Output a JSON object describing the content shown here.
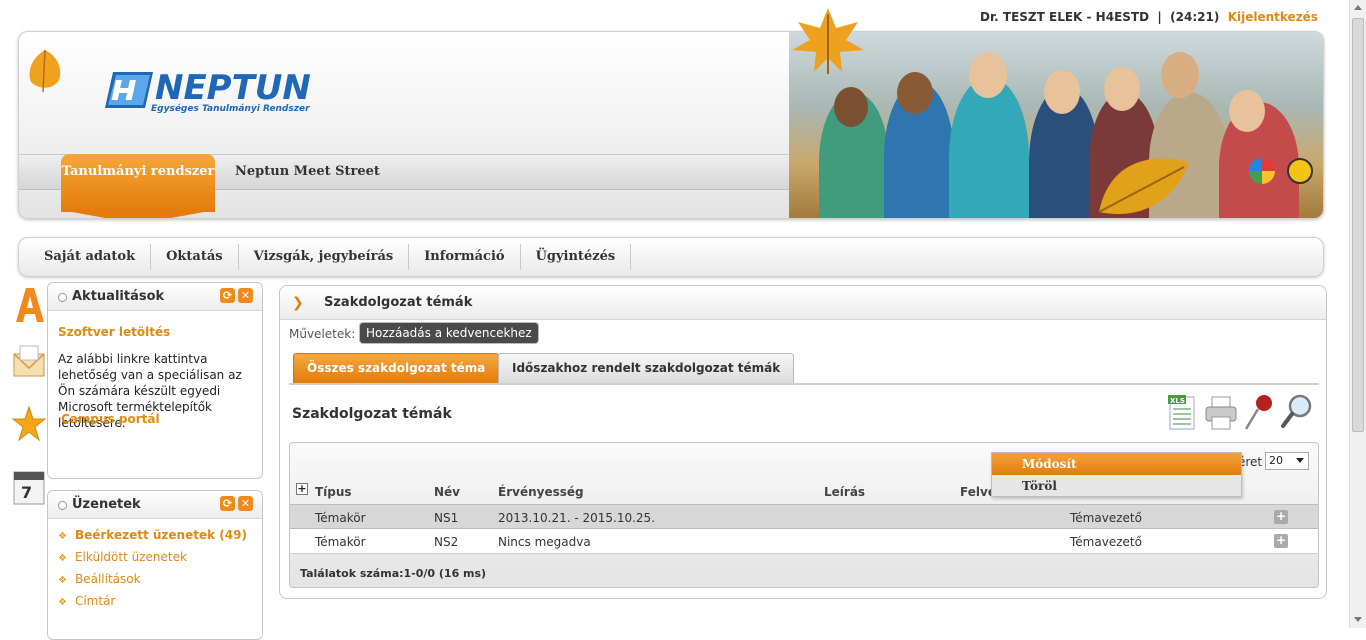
{
  "user": {
    "name": "Dr. TESZT ELEK - H4ESTD",
    "separator": "|",
    "session_timer": "(24:21)",
    "logout": "Kijelentkezés"
  },
  "brand": {
    "logo_text": "NEPTUN",
    "logo_subtitle": "Egységes Tanulmányi Rendszer"
  },
  "header_tabs": [
    {
      "label": "Tanulmányi rendszer",
      "active": true
    },
    {
      "label": "Neptun Meet Street",
      "active": false
    }
  ],
  "main_nav": [
    {
      "label": "Saját adatok"
    },
    {
      "label": "Oktatás"
    },
    {
      "label": "Vizsgák, jegybeírás"
    },
    {
      "label": "Információ"
    },
    {
      "label": "Ügyintézés"
    }
  ],
  "side_icons": [
    "font-size-icon",
    "envelope-icon",
    "favorites-star-icon",
    "calendar-icon"
  ],
  "news_box": {
    "title": "Aktualitások",
    "link_title": "Szoftver letöltés",
    "body": "Az alábbi linkre kattintva lehetőség van a speciálisan az Ön számára készült egyedi Microsoft terméktelepítők letöltésére.",
    "link2": "Campus portál"
  },
  "messages_box": {
    "title": "Üzenetek",
    "items": [
      {
        "label": "Beérkezett üzenetek (49)",
        "bold": true
      },
      {
        "label": "Elküldött üzenetek",
        "bold": false
      },
      {
        "label": "Beállítások",
        "bold": false
      },
      {
        "label": "Címtár",
        "bold": false
      }
    ]
  },
  "content": {
    "title": "Szakdolgozat témák",
    "operations_label": "Műveletek:",
    "add_favorite": "Hozzáadás a kedvencekhez",
    "tabs": [
      {
        "label": "Összes szakdolgozat téma",
        "active": true
      },
      {
        "label": "Időszakhoz rendelt szakdolgozat témák",
        "active": false
      }
    ],
    "list_title": "Szakdolgozat témák",
    "toolbar_icons": [
      "excel-export-icon",
      "print-icon",
      "pin-icon",
      "search-icon"
    ]
  },
  "grid": {
    "page_size_label": "éret",
    "page_size": "20",
    "columns": [
      "Típus",
      "Név",
      "Érvényesség",
      "Leírás",
      "Felve"
    ],
    "rows": [
      {
        "tipus": "Témakör",
        "nev": "NS1",
        "ervenyesseg": "2013.10.21. - 2015.10.25.",
        "leiras": "",
        "role": "Témavezető",
        "selected": true
      },
      {
        "tipus": "Témakör",
        "nev": "NS2",
        "ervenyesseg": "Nincs megadva",
        "leiras": "",
        "role": "Témavezető",
        "selected": false
      }
    ],
    "result_count": "Találatok száma:1-0/0 (16 ms)"
  },
  "context_menu": {
    "items": [
      {
        "label": "Módosít",
        "highlighted": true
      },
      {
        "label": "Töröl",
        "highlighted": false
      }
    ]
  },
  "colors": {
    "accent_orange": "#e47b0a",
    "link_orange": "#e08a10",
    "brand_blue": "#1e68b7"
  }
}
